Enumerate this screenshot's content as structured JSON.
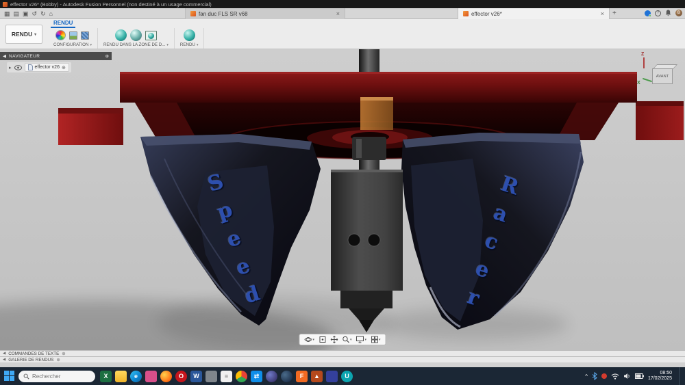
{
  "icons": {
    "caret": "▾",
    "close": "×",
    "plus": "+",
    "target": "⊕",
    "collapse_left": "◀",
    "expand_tree": "▸",
    "home": "⌂",
    "app_grid": "▦",
    "file": "▤",
    "save": "▣",
    "undo": "↺",
    "redo": "↻",
    "question": "?",
    "chevron_up": "^",
    "avatar_initial": "B"
  },
  "title_bar": {
    "title": "effector v26* (Bobby) - Autodesk Fusion Personnel (non destiné à un usage commercial)"
  },
  "tab_bar": {
    "tabs": [
      {
        "label": "fan duc FLS  SR v68"
      },
      {
        "label": "effector v26*"
      }
    ]
  },
  "ribbon": {
    "render_button": "RENDU",
    "active_tab": "RENDU",
    "groups": [
      {
        "label": "CONFIGURATION"
      },
      {
        "label": "RENDU DANS LA ZONE DE D..."
      },
      {
        "label": "RENDU"
      }
    ]
  },
  "navigator": {
    "title": "NAVIGATEUR",
    "root_item": "effector v26"
  },
  "viewport": {
    "viewcube_label": "AVANT",
    "axis_z": "Z",
    "axis_x": "X",
    "duct_text_left": "Speed",
    "duct_text_right": "Racer"
  },
  "bottom_panels": [
    {
      "label": "COMMANDES DE TEXTE"
    },
    {
      "label": "GALERIE DE RENDUS"
    }
  ],
  "taskbar": {
    "search_placeholder": "Rechercher",
    "clock_time": "08:50",
    "clock_date": "17/02/2025",
    "apps": [
      {
        "name": "excel",
        "bg": "#1d6f42",
        "glyph": "X"
      },
      {
        "name": "file-explorer",
        "bg": "linear-gradient(#ffd75e,#f0b429)",
        "glyph": ""
      },
      {
        "name": "edge",
        "bg": "linear-gradient(135deg,#35c1f1,#0a84d0 60%,#155e95)",
        "glyph": "e",
        "round": true
      },
      {
        "name": "photos",
        "bg": "#d94f8a",
        "glyph": ""
      },
      {
        "name": "firefox",
        "bg": "radial-gradient(circle at 35% 35%,#ffd24d,#ff7a1a 60%,#e83e00)",
        "glyph": "",
        "round": true
      },
      {
        "name": "opera",
        "bg": "#c6151c",
        "glyph": "O",
        "round": true
      },
      {
        "name": "word",
        "bg": "#2b579a",
        "glyph": "W"
      },
      {
        "name": "camera",
        "bg": "#80868c",
        "glyph": ""
      },
      {
        "name": "notepad",
        "bg": "#f0f0f0",
        "glyph": "≡",
        "fg": "#777"
      },
      {
        "name": "chrome",
        "bg": "conic-gradient(#ea4335 0deg 120deg,#34a853 120deg 240deg,#fbbc05 240deg 360deg)",
        "glyph": "",
        "round": true
      },
      {
        "name": "teamviewer",
        "bg": "#0e8ee9",
        "glyph": "⇄"
      },
      {
        "name": "eclipse",
        "bg": "radial-gradient(circle at 35% 35%,#6f7ac8,#2c2255)",
        "glyph": "",
        "round": true
      },
      {
        "name": "steam",
        "bg": "radial-gradient(circle at 35% 35%,#4a6b8a,#11203a)",
        "glyph": "",
        "round": true
      },
      {
        "name": "fusion-360",
        "bg": "#f26a22",
        "glyph": "F"
      },
      {
        "name": "vlc",
        "bg": "#b5491c",
        "glyph": "▲"
      },
      {
        "name": "visual-studio",
        "bg": "#34409c",
        "glyph": ""
      },
      {
        "name": "cura",
        "bg": "#0ca5b0",
        "glyph": "U",
        "round": true
      }
    ]
  }
}
